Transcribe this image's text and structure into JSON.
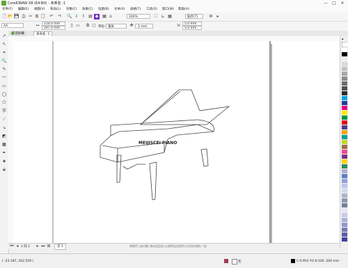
{
  "window": {
    "title": "CorelDRAW X8 (64-Bit) - 未命名 -1",
    "controls": [
      "—",
      "□",
      "✕"
    ]
  },
  "menus": [
    "文件(F)",
    "编辑(E)",
    "视图(V)",
    "布局(L)",
    "对象(C)",
    "效果(C)",
    "位图(B)",
    "文本(X)",
    "表格(T)",
    "工具(O)",
    "窗口(W)",
    "帮助(H)"
  ],
  "standard_toolbar": {
    "zoom": "100%",
    "snap": "贴齐(T)"
  },
  "property_bar": {
    "page_size": "A4",
    "width": "210.0 mm",
    "height": "297.0 mm",
    "units_label": "单位:",
    "units": "毫米",
    "nudge": ".1 mm",
    "dup_x": "5.0 mm",
    "dup_y": "5.0 mm"
  },
  "tabs": {
    "welcome": "欢迎屏幕",
    "doc": "未命名 -1"
  },
  "canvas": {
    "piano_brand": "MEIJISCEI PIANO"
  },
  "page_nav": {
    "current": "1 的 1",
    "page_tab": "页 1"
  },
  "status": {
    "hint": "将颜色 (或对象) 拖动至此处,以便将这些颜色与文档存储在一起",
    "coords": "( -23.187, 262.559 )",
    "color_info": "C:0 M:0 Y:0 K:100 .200 mm",
    "fill_none_label": "无"
  },
  "colors": {
    "accent": "#5ba832",
    "palette": [
      "#ffffff",
      "#000000",
      "#ececec",
      "#d9d9d9",
      "#c2c2c2",
      "#a8a8a8",
      "#8c8c8c",
      "#6e6e6e",
      "#505050",
      "#2b2b2b",
      "#00a4e4",
      "#1d3f99",
      "#e6007e",
      "#ffed00",
      "#009640",
      "#e30613",
      "#4f3b8c",
      "#f7a600",
      "#00a19a",
      "#c2d72f",
      "#9b6c47",
      "#e94d92",
      "#7b2d88",
      "#ffd200",
      "#2e8b57",
      "#b0b0d0",
      "#5e7ec4",
      "#8fa3d6",
      "#b7c6e8",
      "#d1d9ef",
      "#aab4c7",
      "#8d98ae",
      "#70809a",
      "#e5e5f5",
      "#c9cbe6",
      "#aeb0d7",
      "#9295c8",
      "#7779b8",
      "#5b5ea9",
      "#3f429a"
    ]
  }
}
